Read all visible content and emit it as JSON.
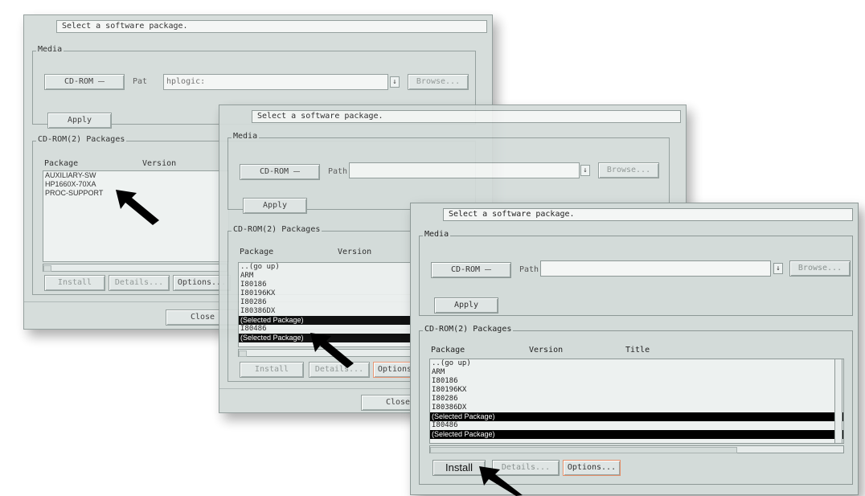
{
  "window1": {
    "status": "Select a software package.",
    "media_label": "Media",
    "media_value": "CD-ROM",
    "path_label": "Pat",
    "path_value": "hplogic:",
    "browse": "Browse...",
    "apply": "Apply",
    "packages_label": "CD-ROM(2) Packages",
    "col_package": "Package",
    "col_version": "Version",
    "rows": [
      {
        "name": "AUXILIARY-SW"
      },
      {
        "name": "HP1660X-70XA"
      },
      {
        "name": "PROC-SUPPORT"
      }
    ],
    "install": "Install",
    "details": "Details...",
    "options": "Options...",
    "close": "Close"
  },
  "window2": {
    "status": "Select a software package.",
    "media_label": "Media",
    "media_value": "CD-ROM",
    "path_label": "Path",
    "browse": "Browse...",
    "apply": "Apply",
    "packages_label": "CD-ROM(2) Packages",
    "col_package": "Package",
    "col_version": "Version",
    "rows": [
      {
        "name": "..(go up)"
      },
      {
        "name": "ARM"
      },
      {
        "name": "I80186"
      },
      {
        "name": "I80196KX"
      },
      {
        "name": "I80286"
      },
      {
        "name": "I80386DX"
      },
      {
        "name": "(Selected Package)",
        "selected": true
      },
      {
        "name": "I80486"
      },
      {
        "name": "(Selected Package)",
        "selected": true
      }
    ],
    "install": "Install",
    "details": "Details...",
    "options": "Options...",
    "close": "Close"
  },
  "window3": {
    "status": "Select a software package.",
    "media_label": "Media",
    "media_value": "CD-ROM",
    "path_label": "Path",
    "browse": "Browse...",
    "apply": "Apply",
    "packages_label": "CD-ROM(2) Packages",
    "col_package": "Package",
    "col_version": "Version",
    "col_title": "Title",
    "rows": [
      {
        "name": "..(go up)"
      },
      {
        "name": "ARM"
      },
      {
        "name": "I80186"
      },
      {
        "name": "I80196KX"
      },
      {
        "name": "I80286"
      },
      {
        "name": "I80386DX"
      },
      {
        "name": "(Selected Package)",
        "selected": true
      },
      {
        "name": "I80486"
      },
      {
        "name": "(Selected Package)",
        "selected": true
      }
    ],
    "install": "Install",
    "details": "Details...",
    "options": "Options..."
  },
  "icons": {
    "pointer": "arrow-pointer-icon",
    "dropdown": "dropdown-menu-icon",
    "download": "download-icon"
  },
  "colors": {
    "window_bg": "#d3dbd9",
    "selection": "#000000",
    "highlight_border": "#e28e6a"
  }
}
